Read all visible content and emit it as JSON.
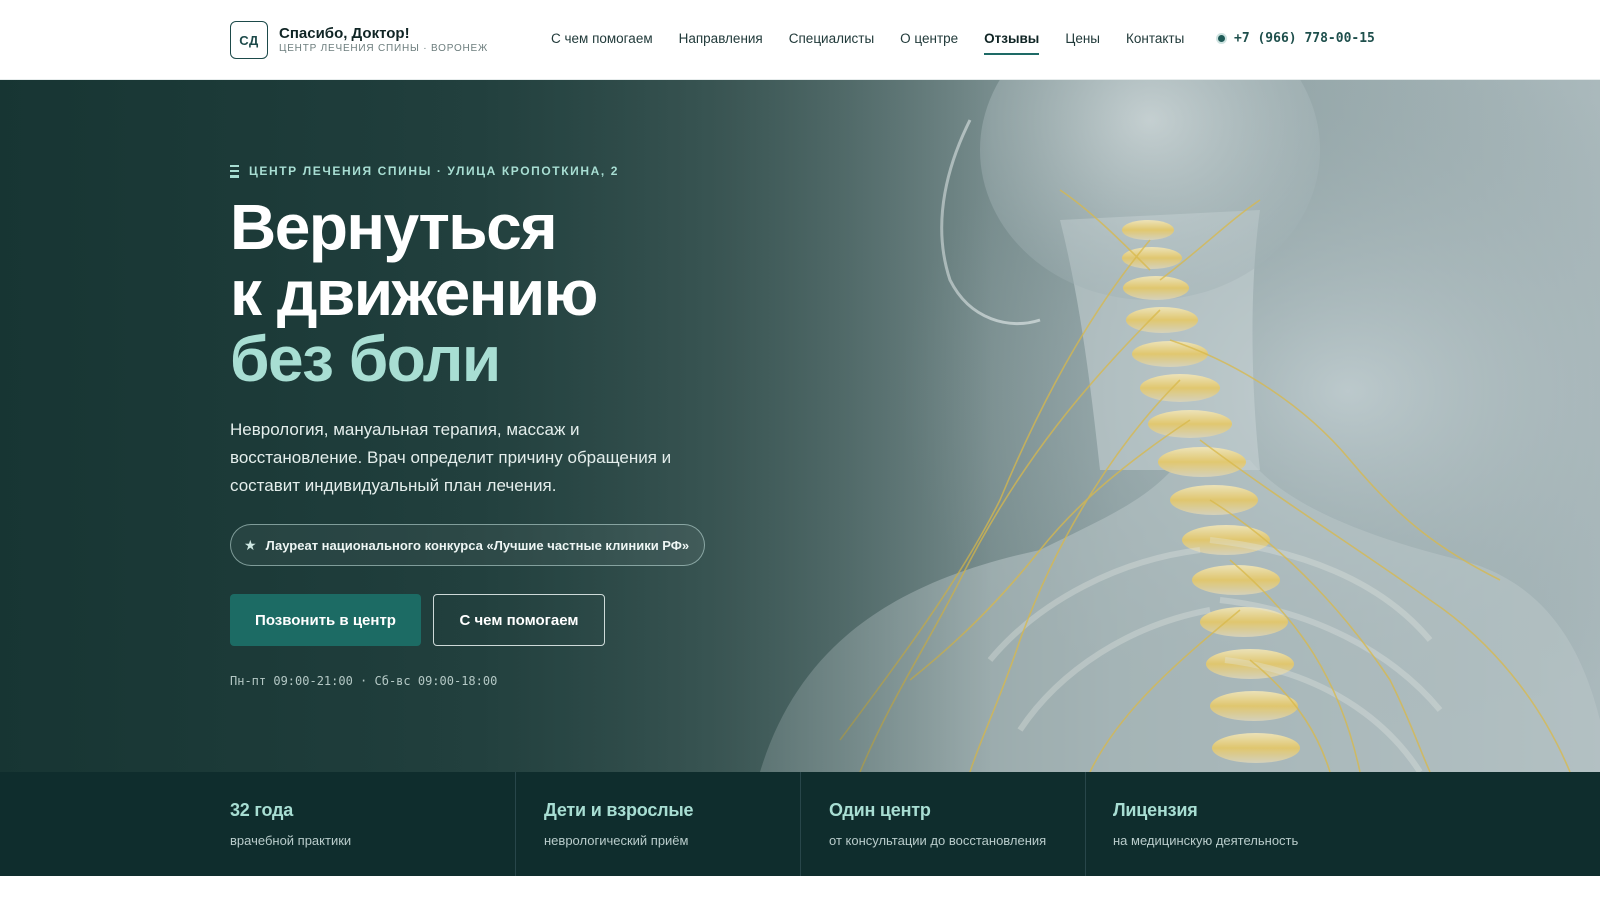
{
  "brand": {
    "logo_mark": "СД",
    "name": "Спасибо, Доктор!",
    "subtitle": "ЦЕНТР ЛЕЧЕНИЯ СПИНЫ · ВОРОНЕЖ"
  },
  "nav": {
    "items": [
      {
        "label": "С чем помогаем",
        "active": false
      },
      {
        "label": "Направления",
        "active": false
      },
      {
        "label": "Специалисты",
        "active": false
      },
      {
        "label": "О центре",
        "active": false
      },
      {
        "label": "Отзывы",
        "active": true
      },
      {
        "label": "Цены",
        "active": false
      },
      {
        "label": "Контакты",
        "active": false
      }
    ],
    "phone": "+7 (966) 778-00-15"
  },
  "hero": {
    "eyebrow": "ЦЕНТР ЛЕЧЕНИЯ СПИНЫ · УЛИЦА КРОПОТКИНА, 2",
    "title_line1": "Вернуться",
    "title_line2": "к движению",
    "title_accent": "без боли",
    "lead": "Неврология, мануальная терапия, массаж и восстановление. Врач определит причину обращения и составит индивидуальный план лечения.",
    "award": "Лауреат национального конкурса «Лучшие частные клиники РФ»",
    "cta_primary": "Позвонить в центр",
    "cta_secondary": "С чем помогаем",
    "hours": "Пн-пт 09:00-21:00 · Сб-вс 09:00-18:00"
  },
  "stats": [
    {
      "title": "32 года",
      "subtitle": "врачебной практики"
    },
    {
      "title": "Дети и взрослые",
      "subtitle": "неврологический приём"
    },
    {
      "title": "Один центр",
      "subtitle": "от консультации до восстановления"
    },
    {
      "title": "Лицензия",
      "subtitle": "на медицинскую деятельность"
    }
  ],
  "colors": {
    "accent": "#a8ded3",
    "primary_button": "#1c6b64",
    "stats_bg": "#0f2d2d",
    "nerve": "#d9b94a"
  },
  "icons": {
    "award": "star-icon",
    "phone": "status-dot-icon",
    "eyebrow": "bars-icon"
  }
}
